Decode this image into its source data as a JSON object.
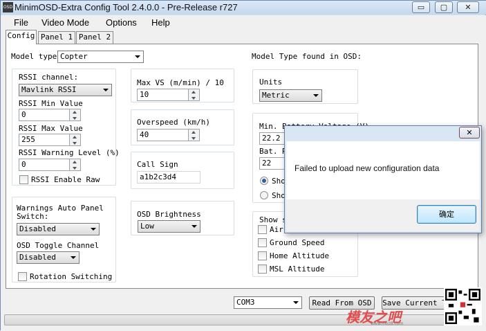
{
  "window": {
    "title": "MinimOSD-Extra Config Tool 2.4.0.0 - Pre-Release r727",
    "app_icon_text": "OSD",
    "minimize_glyph": "▭",
    "maximize_glyph": "▢",
    "close_glyph": "✕"
  },
  "menu": [
    "File",
    "Video Mode",
    "Options",
    "Help"
  ],
  "tabs": [
    "Config",
    "Panel 1",
    "Panel 2"
  ],
  "config": {
    "model_type_label": "Model type:",
    "model_type_value": "Copter",
    "model_found_label": "Model Type found in OSD:",
    "rssi_channel_label": "RSSI channel:",
    "rssi_channel_value": "Mavlink RSSI",
    "rssi_min_label": "RSSI Min Value",
    "rssi_min_value": "0",
    "rssi_max_label": "RSSI Max Value",
    "rssi_max_value": "255",
    "rssi_warn_label": "RSSI Warning Level (%)",
    "rssi_warn_value": "0",
    "rssi_enable_raw_label": "RSSI Enable Raw",
    "max_vs_label": "Max VS (m/min) / 10",
    "max_vs_value": "10",
    "overspeed_label": "Overspeed (km/h)",
    "overspeed_value": "40",
    "call_sign_label": "Call Sign",
    "call_sign_value": "a1b2c3d4",
    "osd_brightness_label": "OSD Brightness",
    "osd_brightness_value": "Low",
    "warnings_auto_label_1": "Warnings Auto Panel",
    "warnings_auto_label_2": "Switch:",
    "warnings_auto_value": "Disabled",
    "osd_toggle_label": "OSD Toggle Channel",
    "osd_toggle_value": "Disabled",
    "rotation_switching_label": "Rotation Switching",
    "units_label": "Units",
    "units_value": "Metric",
    "min_battery_label": "Min. Battery Voltage (V)",
    "min_battery_value": "22.2",
    "bat_r_label": "Bat. R",
    "bat_r_value": "22",
    "show_radio_1": "Sho",
    "show_radio_2": "Sho",
    "show_group_label": "Show s",
    "show_air_label": "Air",
    "ground_speed_label": "Ground Speed",
    "home_altitude_label": "Home Altitude",
    "msl_altitude_label": "MSL Altitude"
  },
  "bottom": {
    "com_port": "COM3",
    "read_button": "Read From OSD",
    "save_button": "Save Current T"
  },
  "progress_fraction": 0.0,
  "dialog": {
    "message": "Failed to upload new configuration data",
    "ok_label": "确定",
    "close_glyph": "✕"
  },
  "watermark": {
    "text": "模友之吧",
    "url": "www.moz8.com"
  },
  "colors": {
    "accent": "#2c5fa7",
    "progress": "#5fc05f",
    "watermark": "#e23c3c"
  }
}
